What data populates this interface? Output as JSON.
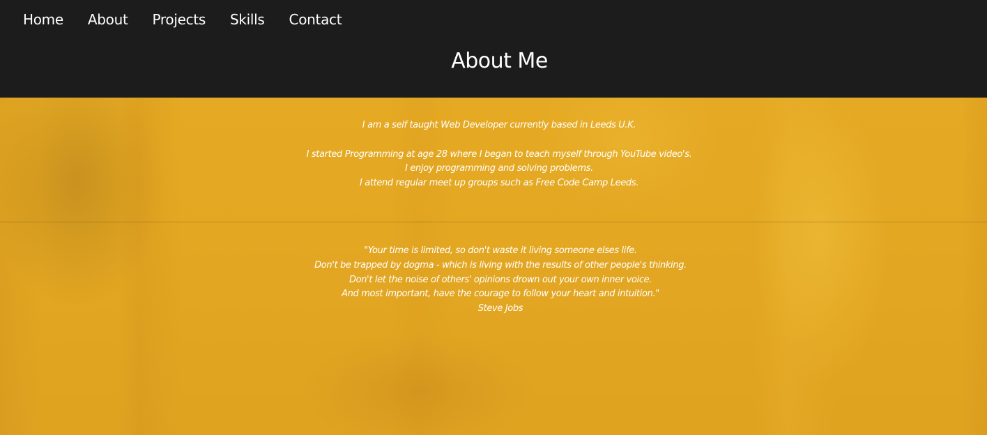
{
  "nav": {
    "items": [
      {
        "label": "Home"
      },
      {
        "label": "About"
      },
      {
        "label": "Projects"
      },
      {
        "label": "Skills"
      },
      {
        "label": "Contact"
      }
    ]
  },
  "header": {
    "title": "About Me"
  },
  "about": {
    "intro": "I am a self taught Web Developer currently based in Leeds U.K.",
    "lines": [
      "I started Programming at age 28 where I began to teach myself through YouTube video's.",
      "I enjoy programming and solving problems.",
      "I attend regular meet up groups such as Free Code Camp Leeds."
    ]
  },
  "quote": {
    "lines": [
      "\"Your time is limited, so don't waste it living someone elses life.",
      "Don't be trapped by dogma - which is living with the results of other people's thinking.",
      "Don't let the noise of others' opinions drown out your own inner voice.",
      "And most important, have the courage to follow your heart and intuition.\""
    ],
    "author": "Steve Jobs"
  },
  "colors": {
    "header_background": "#1c1c1c",
    "main_background": "#e3a722",
    "text": "#ffffff"
  }
}
